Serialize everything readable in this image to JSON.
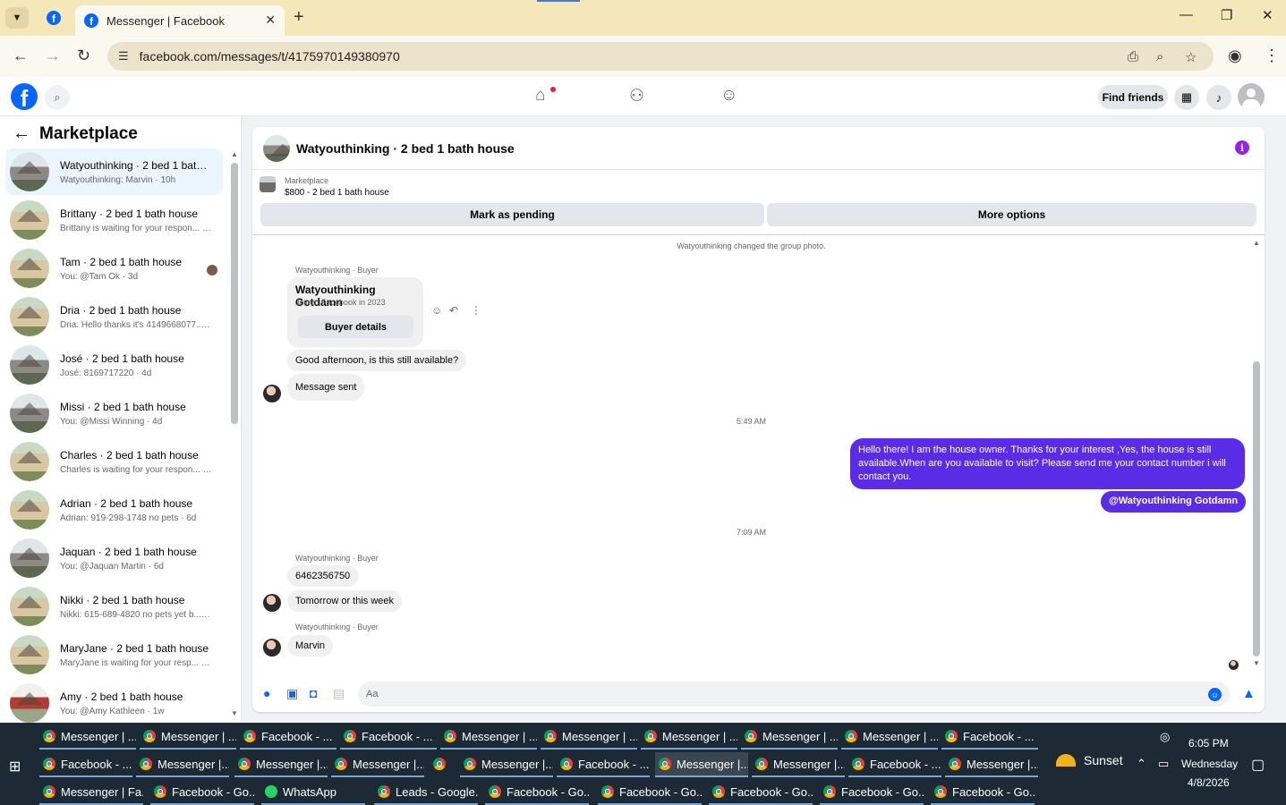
{
  "browser": {
    "tab_title": "Messenger | Facebook",
    "new_tab": "+",
    "url": "facebook.com/messages/t/4175970149380970"
  },
  "fb_header": {
    "find_friends": "Find friends"
  },
  "sidebar": {
    "title": "Marketplace",
    "conversations": [
      {
        "title": "Watyouthinking · 2 bed 1 bath ...",
        "sub": "Watyouthinking: Marvin · 10h",
        "active": true
      },
      {
        "title": "Brittany · 2 bed 1 bath house",
        "sub": "Brittany is waiting for your respon... · 3d"
      },
      {
        "title": "Tam · 2 bed 1 bath house",
        "sub": "You: @Tam Ok · 3d"
      },
      {
        "title": "Dria · 2 bed 1 bath house",
        "sub": "Dria: Hello thanks it's 4149668077... · 4d"
      },
      {
        "title": "José · 2 bed 1 bath house",
        "sub": "José: 8169717220 · 4d"
      },
      {
        "title": "Missi · 2 bed 1 bath house",
        "sub": "You: @Missi Winning · 4d"
      },
      {
        "title": "Charles · 2 bed 1 bath house",
        "sub": "Charles is waiting for your respon... · 6d"
      },
      {
        "title": "Adrian · 2 bed 1 bath house",
        "sub": "Adrian: 919-298-1748 no pets · 6d"
      },
      {
        "title": "Jaquan · 2 bed 1 bath house",
        "sub": "You: @Jaquan Martin · 6d"
      },
      {
        "title": "Nikki · 2 bed 1 bath house",
        "sub": "Nikki: 615-689-4820 no pets yet b... · 6d"
      },
      {
        "title": "MaryJane · 2 bed 1 bath house",
        "sub": "MaryJane is waiting for your resp... · 1w"
      },
      {
        "title": "Amy · 2 bed 1 bath house",
        "sub": "You: @Amy Kathleen · 1w"
      }
    ]
  },
  "chat": {
    "title": "Watyouthinking · 2 bed 1 bath house",
    "listing_label": "Marketplace",
    "listing_price": "$800 - 2 bed 1 bath house",
    "mark_pending": "Mark as pending",
    "more_options": "More options",
    "system_msg": "Watyouthinking changed the group photo.",
    "sender_label": "Watyouthinking · Buyer",
    "buyer_name": "Watyouthinking Gotdamn",
    "buyer_joined": "Joined Facebook in 2023",
    "buyer_details": "Buyer details",
    "msg1": "Good afternoon, is this still available?",
    "msg2": "Message sent",
    "time1": "5:49 AM",
    "out_msg": "Hello there! I am the house owner. Thanks for your interest ,Yes, the house is still available.When are you available to visit? Please send me your contact number i will contact you.",
    "out_mention": "@Watyouthinking Gotdamn",
    "time2": "7:09 AM",
    "msg3": "6462356750",
    "msg4": "Tomorrow or this week",
    "msg5": "Marvin",
    "composer_placeholder": "Aa"
  },
  "taskbar": {
    "row1": [
      "Messenger | ...",
      "Messenger | ...",
      "Facebook - ...",
      "Facebook - ...",
      "Messenger | ...",
      "Messenger | ...",
      "Messenger | ...",
      "Messenger | ...",
      "Messenger | ...",
      "Facebook - ..."
    ],
    "row2": [
      "Facebook - ...",
      "Messenger |...",
      "Messenger |...",
      "Messenger |...",
      "",
      "Messenger |...",
      "Facebook - ...",
      "Messenger |...",
      "Messenger |...",
      "Facebook - ...",
      "Messenger |..."
    ],
    "row3": [
      "Messenger | Fa...",
      "Facebook - Go...",
      "WhatsApp",
      "Leads - Google...",
      "Facebook - Go...",
      "Facebook - Go...",
      "Facebook - Go...",
      "Facebook - Go...",
      "Facebook - Go..."
    ],
    "weather": "Sunset",
    "time": "6:05 PM",
    "day": "Wednesday",
    "date": "4/8/2026"
  },
  "colors": {
    "outgoing_bubble": "#5b2ce6",
    "facebook_blue": "#0866ff",
    "info_purple": "#9b1fe8"
  }
}
